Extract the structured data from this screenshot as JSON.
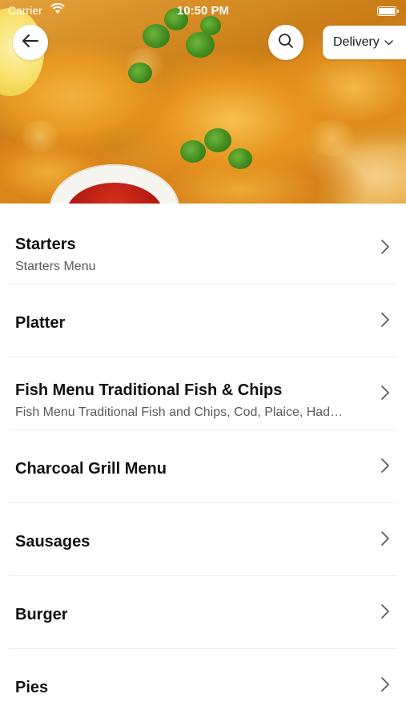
{
  "status_bar": {
    "carrier": "Carrier",
    "time": "10:50 PM"
  },
  "header": {
    "back_icon": "arrow-left-icon",
    "search_icon": "search-icon",
    "delivery_label": "Delivery",
    "delivery_icon": "chevron-down-icon"
  },
  "categories": [
    {
      "title": "Starters",
      "subtitle": "Starters Menu"
    },
    {
      "title": "Platter",
      "subtitle": ""
    },
    {
      "title": "Fish Menu Traditional Fish & Chips",
      "subtitle": "Fish Menu Traditional Fish and Chips, Cod, Plaice, Had…"
    },
    {
      "title": "Charcoal Grill Menu",
      "subtitle": ""
    },
    {
      "title": "Sausages",
      "subtitle": ""
    },
    {
      "title": "Burger",
      "subtitle": ""
    },
    {
      "title": "Pies",
      "subtitle": ""
    }
  ],
  "colors": {
    "title": "#111111",
    "subtitle": "#5a5a5a",
    "divider": "#ececec"
  }
}
